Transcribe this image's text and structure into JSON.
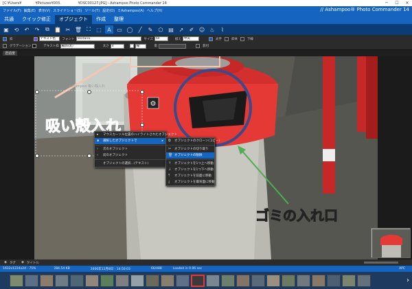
{
  "window": {
    "title": "[C:¥Users¥　　　　¥Pictures¥003.　　　　　¥DSC00127.JPG] - Ashampoo Photo Commander 14"
  },
  "menu": {
    "items": [
      "ファイル(F)",
      "編集(E)",
      "表示(V)",
      "スライドショー(S)",
      "ツール(T)",
      "設定(O)",
      "ミAshampoo(A)",
      "ヘルプ(H)"
    ],
    "brand": "// Ashampoo® Photo Commander 14"
  },
  "tabs": [
    "共通",
    "クイック修正",
    "オブジェクト",
    "作成",
    "整理"
  ],
  "active_tab": 2,
  "toolbar": {
    "row2": {
      "outline_label": "枠",
      "text_color_label": "テキスト色",
      "font_label": "フォント",
      "font_value": "Verdana",
      "size_label": "サイズ",
      "size_value": "64",
      "align_label": "揃え",
      "align_value": "中央",
      "bold_label": "太字",
      "italic_label": "斜体",
      "underline_label": "下線"
    },
    "row3": {
      "gradient_label": "グラデーション",
      "text_border_label": "テキスト枠",
      "text_border_value": "輪郭(太)",
      "width_label": "太さ",
      "width_value": "4",
      "style_label": "線",
      "shadow_label": "影",
      "shadow2_label": "影付"
    }
  },
  "subtab_label": "透過度",
  "canvas": {
    "caption_main": "吸い殻入れ",
    "caption_arrow": "ゴミの入れ口",
    "ghost_text": "Ashampoo 吸い殻入れ"
  },
  "context_menu": {
    "items": [
      {
        "icon": "cursor-icon",
        "label": "マウスカーソル位置のハイライトされたオブジェクト",
        "highlight": false
      },
      {
        "icon": "select-icon",
        "label": "選択したオブジェクトで",
        "highlight": true
      },
      {
        "icon": "",
        "label": "",
        "separator": true
      },
      {
        "icon": "next-icon",
        "label": "次のオブジェクト",
        "highlight": false
      },
      {
        "icon": "prev-icon",
        "label": "前のオブジェクト",
        "highlight": false
      },
      {
        "icon": "",
        "label": "",
        "separator": true
      },
      {
        "icon": "",
        "label": "オブジェクトの選択...(テキスト)",
        "highlight": false
      }
    ]
  },
  "submenu": {
    "items": [
      {
        "icon": "copy-icon",
        "label": "オブジェクトのクローン(コピー)",
        "highlight": false
      },
      {
        "icon": "",
        "label": "",
        "separator": true
      },
      {
        "icon": "cut-icon",
        "label": "オブジェクトの切り取り",
        "highlight": false
      },
      {
        "icon": "delete-icon",
        "label": "オブジェクトの削除",
        "highlight": true
      },
      {
        "icon": "",
        "label": "",
        "separator": true
      },
      {
        "icon": "up-icon",
        "label": "オブジェクトを1つ上へ移動",
        "highlight": false
      },
      {
        "icon": "down-icon",
        "label": "オブジェクトを1つ下へ移動",
        "highlight": false
      },
      {
        "icon": "front-icon",
        "label": "オブジェクトを前面に移動",
        "highlight": false
      },
      {
        "icon": "back-icon",
        "label": "オブジェクトを最背面に移動",
        "highlight": false
      }
    ]
  },
  "infobar": {
    "tag_label": "タグ",
    "title_label": "タイトル"
  },
  "statusbar": {
    "dimensions": "1632x1224x24 - 75%",
    "filesize": "284.54 KB",
    "date": "2006年12月8日 - 14:50:03",
    "index": "66/488",
    "loaded": "Loaded in 0.06 sec",
    "apc": "APC"
  },
  "colors": {
    "accent": "#1565c0",
    "dark_ribbon": "#0b3c73",
    "caption_purple": "#6a5acd"
  }
}
